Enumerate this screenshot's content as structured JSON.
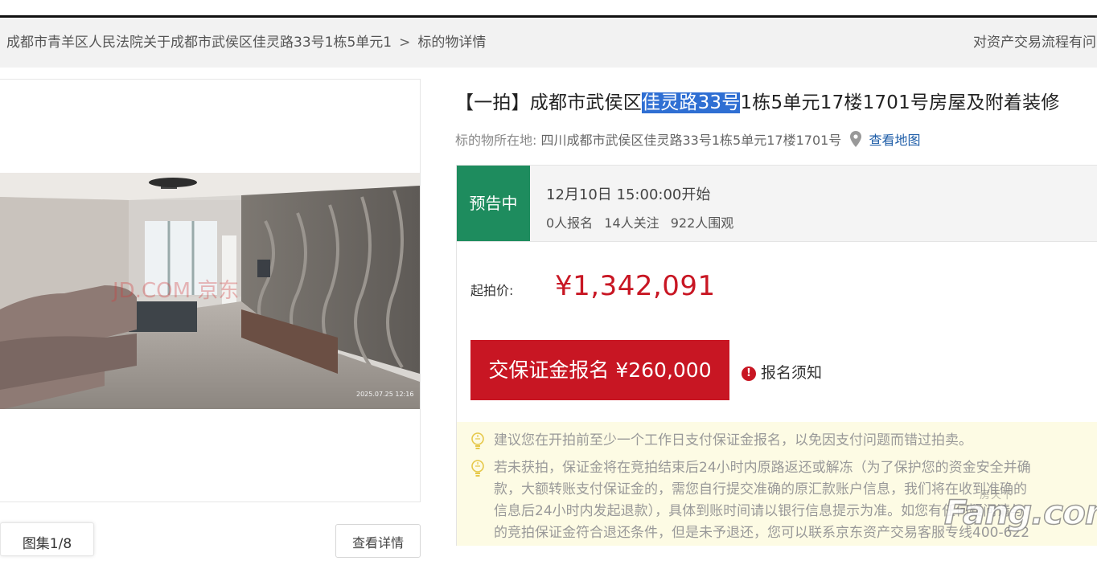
{
  "breadcrumb": {
    "court": "成都市青羊区人民法院关于成都市武侯区佳灵路33号1栋5单元1",
    "separator": ">",
    "current": "标的物详情",
    "right_link": "对资产交易流程有问"
  },
  "gallery": {
    "album_tab": "图集1/8",
    "detail_button": "查看详情",
    "photo_timestamp": "2025.07.25 12:16",
    "photo_watermark": "JD.COM 京东"
  },
  "title": {
    "prefix": "【一拍】成都市武侯区",
    "highlight": "佳灵路33号",
    "suffix": "1栋5单元17楼1701号房屋及附着装修"
  },
  "location": {
    "label": "标的物所在地:",
    "address": "四川成都市武侯区佳灵路33号1栋5单元17楼1701号",
    "map_link": "查看地图"
  },
  "status": {
    "badge": "预告中",
    "start_time": "12月10日 15:00:00开始",
    "signups": "0人报名",
    "followers": "14人关注",
    "viewers": "922人围观"
  },
  "bid": {
    "price_label": "起拍价:",
    "price": "¥1,342,091",
    "deposit_button": "交保证金报名 ¥260,000",
    "notice_link": "报名须知",
    "notice_icon": "!"
  },
  "tips": {
    "tip1": "建议您在开拍前至少一个工作日支付保证金报名，以免因支付问题而错过拍卖。",
    "tip2_lines": [
      "若未获拍，保证金将在竞拍结束后24小时内原路返还或解冻（为了保护您的资金安全并确",
      "款，大额转账支付保证金的，需您自行提交准确的原汇款账户信息，我们将在收到准确的",
      "信息后24小时内发起退款），具体到账时间请以银行信息提示为准。如您有任何疑问请与",
      "的竞拍保证金符合退还条件，但是未予退还，您可以联系京东资产交易客服专线400-622"
    ]
  },
  "watermark": {
    "cn": "房天下",
    "en": "Fang.com"
  },
  "colors": {
    "accent_red": "#c81623",
    "status_green": "#1e8c5e",
    "highlight_blue": "#2f6fd3",
    "link_blue": "#1f5ea8",
    "tip_bg": "#fdfbe4"
  },
  "icons": [
    "location-pin-icon",
    "exclamation-icon",
    "lightbulb-icon"
  ]
}
